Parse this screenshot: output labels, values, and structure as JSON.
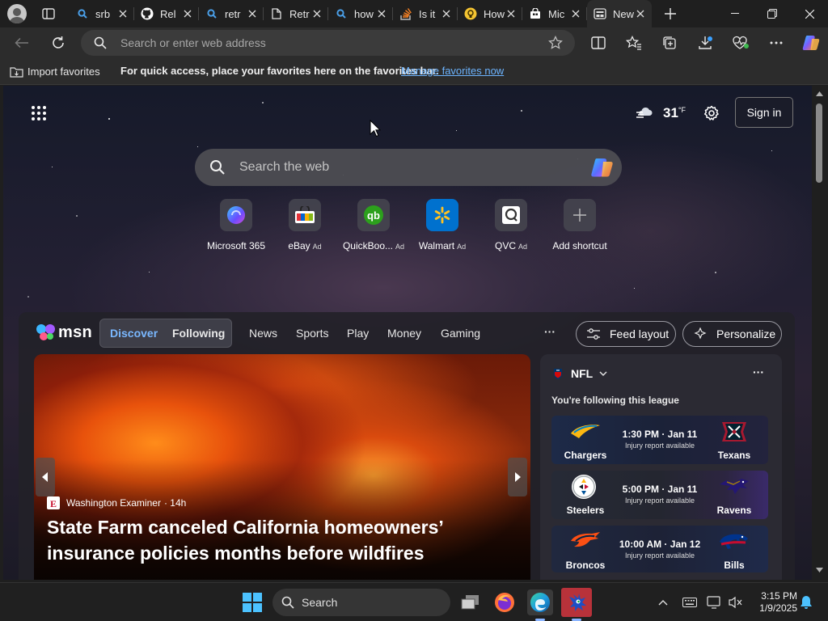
{
  "browser": {
    "tabs": [
      {
        "title": "srb",
        "icon": "search-icon"
      },
      {
        "title": "Rel",
        "icon": "github-icon"
      },
      {
        "title": "retr",
        "icon": "search-icon"
      },
      {
        "title": "Retr",
        "icon": "document-icon"
      },
      {
        "title": "how",
        "icon": "search-icon"
      },
      {
        "title": "Is it",
        "icon": "stackoverflow-icon"
      },
      {
        "title": "How",
        "icon": "bulb-icon"
      },
      {
        "title": "Mic",
        "icon": "store-icon"
      },
      {
        "title": "New",
        "icon": "newtab-icon",
        "active": true
      }
    ],
    "address_placeholder": "Search or enter web address",
    "favorites_bar": {
      "import_label": "Import favorites",
      "message": "For quick access, place your favorites here on the favorites bar.",
      "manage_link": "Manage favorites now"
    }
  },
  "newtab": {
    "weather": {
      "temp": "31",
      "unit": "°F",
      "icon": "windy-cloud-icon"
    },
    "sign_in_label": "Sign in",
    "search_placeholder": "Search the web",
    "shortcuts": [
      {
        "label": "Microsoft 365",
        "ad": "",
        "icon": "m365-icon"
      },
      {
        "label": "eBay",
        "ad": "Ad",
        "icon": "ebay-icon"
      },
      {
        "label": "QuickBoo...",
        "ad": "Ad",
        "icon": "quickbooks-icon"
      },
      {
        "label": "Walmart",
        "ad": "Ad",
        "icon": "walmart-icon"
      },
      {
        "label": "QVC",
        "ad": "Ad",
        "icon": "qvc-icon"
      },
      {
        "label": "Add shortcut",
        "ad": "",
        "icon": "plus-icon"
      }
    ]
  },
  "msn": {
    "brand": "msn",
    "nav": {
      "discover": "Discover",
      "following": "Following",
      "items": [
        "News",
        "Sports",
        "Play",
        "Money",
        "Gaming"
      ],
      "more": "···",
      "feed_layout": "Feed layout",
      "personalize": "Personalize"
    },
    "hero": {
      "source": "Washington Examiner",
      "age": "· 14h",
      "headline_line1": "State Farm canceled California homeowners’",
      "headline_line2": "insurance policies months before wildfires"
    },
    "nfl": {
      "title": "NFL",
      "subtitle": "You're following this league",
      "more": "···",
      "games": [
        {
          "home": "Chargers",
          "away": "Texans",
          "time": "1:30 PM · Jan 11",
          "status": "Injury report available"
        },
        {
          "home": "Steelers",
          "away": "Ravens",
          "time": "5:00 PM · Jan 11",
          "status": "Injury report available"
        },
        {
          "home": "Broncos",
          "away": "Bills",
          "time": "10:00 AM · Jan 12",
          "status": "Injury report available"
        }
      ]
    }
  },
  "taskbar": {
    "search_label": "Search",
    "time": "3:15 PM",
    "date": "1/9/2025"
  }
}
